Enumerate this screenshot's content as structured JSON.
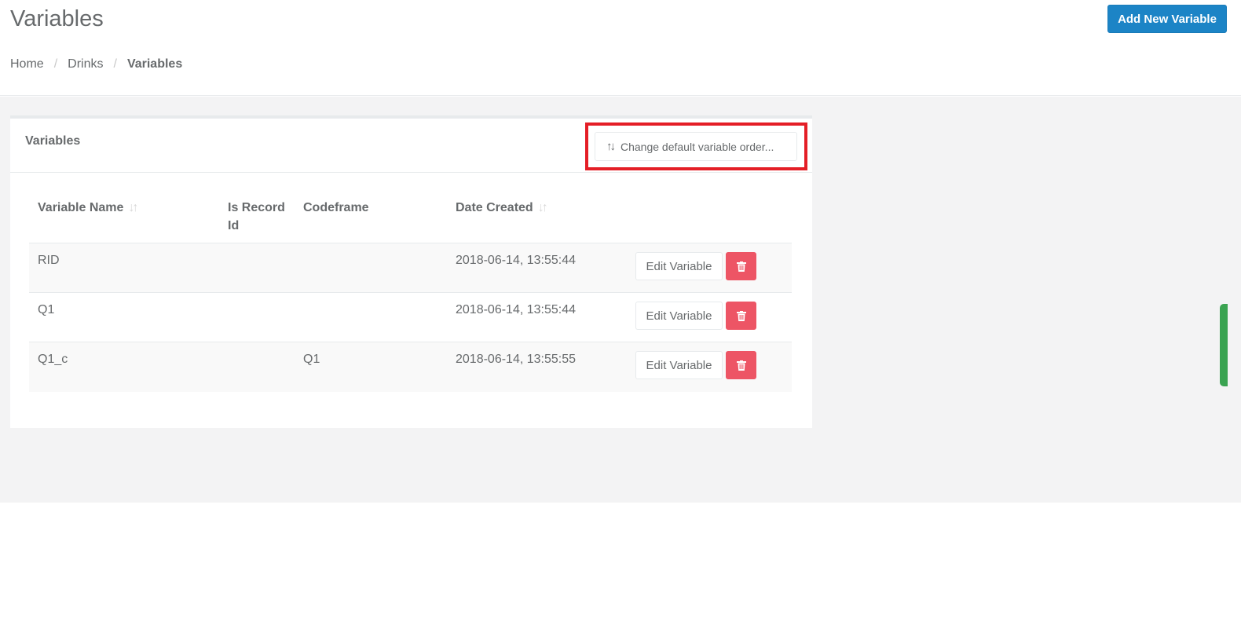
{
  "header": {
    "title": "Variables",
    "add_button_label": "Add New Variable"
  },
  "breadcrumb": {
    "items": [
      "Home",
      "Drinks",
      "Variables"
    ],
    "separator": "/"
  },
  "panel": {
    "title": "Variables",
    "order_button_label": "Change default variable order...",
    "highlight_color": "#e41e26"
  },
  "table": {
    "columns": [
      "Variable Name",
      "Is Record Id",
      "Codeframe",
      "Date Created"
    ],
    "sortable_columns": [
      "Variable Name",
      "Date Created"
    ],
    "rows": [
      {
        "name": "RID",
        "is_record_id": "",
        "codeframe": "",
        "date_created": "2018-06-14, 13:55:44"
      },
      {
        "name": "Q1",
        "is_record_id": "",
        "codeframe": "",
        "date_created": "2018-06-14, 13:55:44"
      },
      {
        "name": "Q1_c",
        "is_record_id": "",
        "codeframe": "Q1",
        "date_created": "2018-06-14, 13:55:55"
      }
    ],
    "edit_button_label": "Edit Variable"
  },
  "colors": {
    "primary": "#1c84c6",
    "danger": "#ed5565",
    "text": "#676a6c",
    "background": "#f3f3f4",
    "side_tab": "#3aa351"
  },
  "icons": {
    "sort": "sort-icon",
    "delete": "trash-icon"
  }
}
